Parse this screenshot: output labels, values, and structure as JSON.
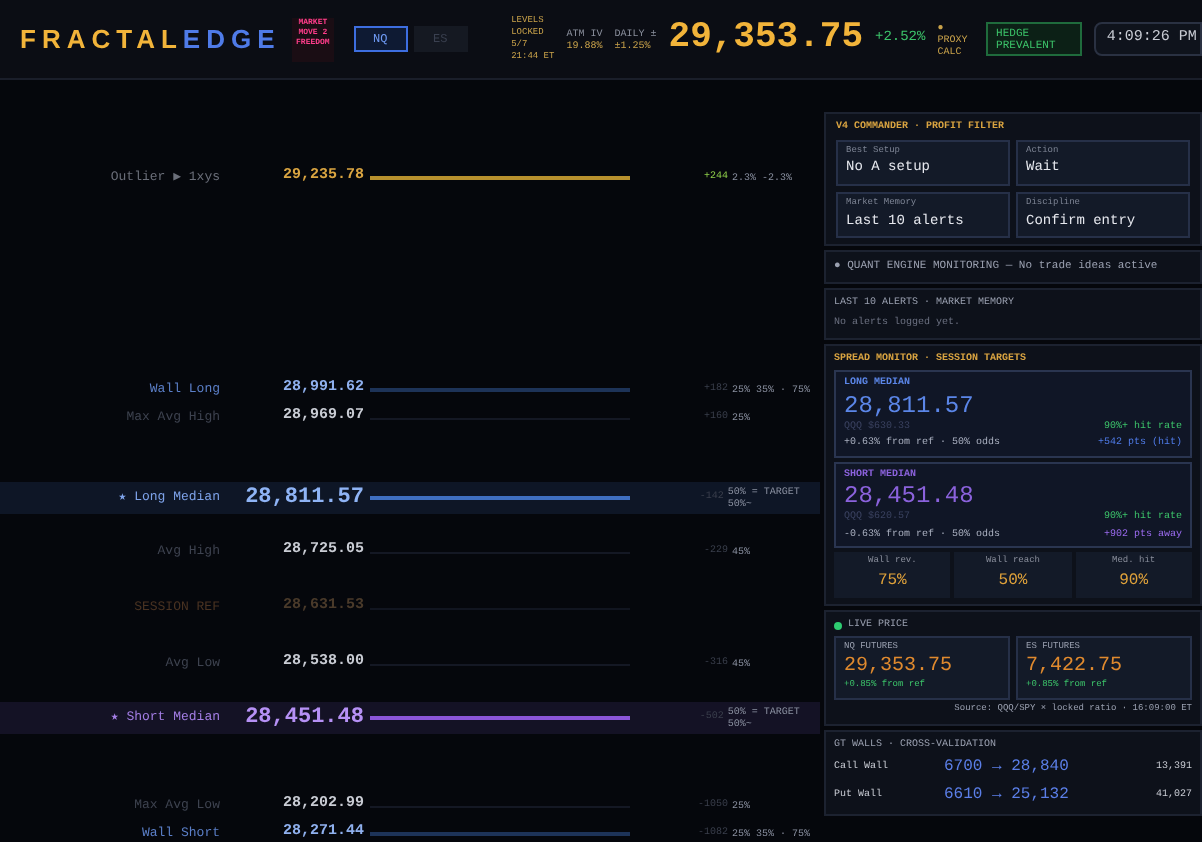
{
  "header": {
    "logo_left": "FRACTAL",
    "logo_right": "EDGE",
    "badge": "MARKET MOVE 2 FREEDOM",
    "instruments": [
      {
        "label": "NQ",
        "selected": true
      },
      {
        "label": "ES",
        "selected": false
      }
    ],
    "levels_status": "LEVELS LOCKED 5/7 21:44 ET",
    "atm_iv": {
      "label": "ATM IV",
      "value": "19.88%"
    },
    "daily": {
      "label": "DAILY ±",
      "value": "±1.25%"
    },
    "price": "29,353.75",
    "change": "+2.52%",
    "proxy": "● PROXY CALC",
    "regime": "HEDGE PREVALENT",
    "time": "4:09:26 PM"
  },
  "ladder": [
    {
      "kind": "outlier",
      "label": "Outlier ▶ 1xys",
      "price": "29,235.78",
      "delta": "+244",
      "odds": "2.3% -2.3%"
    },
    {
      "kind": "wall",
      "label": "Wall Long",
      "price": "28,991.62",
      "delta": "+182",
      "odds": "25% 35% · 75%"
    },
    {
      "kind": "minor",
      "label": "Max Avg High",
      "price": "28,969.07",
      "delta": "+160",
      "odds": "25%"
    },
    {
      "kind": "long_median",
      "label": "★ Long Median",
      "price": "28,811.57",
      "delta": "-142",
      "odds": "50% = TARGET 50%~"
    },
    {
      "kind": "minor",
      "label": "Avg High",
      "price": "28,725.05",
      "delta": "-229",
      "odds": "45%"
    },
    {
      "kind": "ref",
      "label": "SESSION REF",
      "price": "28,631.53"
    },
    {
      "kind": "minor",
      "label": "Avg Low",
      "price": "28,538.00",
      "delta": "-316",
      "odds": "45%"
    },
    {
      "kind": "short_median",
      "label": "★ Short Median",
      "price": "28,451.48",
      "delta": "-502",
      "odds": "50% = TARGET 50%~"
    },
    {
      "kind": "minor",
      "label": "Max Avg Low",
      "price": "28,202.99",
      "delta": "-1050",
      "odds": "25%"
    },
    {
      "kind": "wall",
      "label": "Wall Short",
      "price": "28,271.44",
      "delta": "-1082",
      "odds": "25% 35% · 75%"
    }
  ],
  "commander": {
    "title": "V4 COMMANDER · PROFIT FILTER",
    "cells": [
      {
        "label": "Best Setup",
        "value": "No A setup"
      },
      {
        "label": "Action",
        "value": "Wait"
      },
      {
        "label": "Market Memory",
        "value": "Last 10 alerts"
      },
      {
        "label": "Discipline",
        "value": "Confirm entry"
      }
    ]
  },
  "engine_status": "● QUANT ENGINE MONITORING — No trade ideas active",
  "alerts": {
    "title": "LAST 10 ALERTS · MARKET MEMORY",
    "empty": "No alerts logged yet."
  },
  "spread": {
    "title": "SPREAD MONITOR · SESSION TARGETS",
    "targets": [
      {
        "kind": "long",
        "label": "LONG MEDIAN",
        "price": "28,811.57",
        "proxy": "QQQ $630.33",
        "detail": "+0.63% from ref · 50% odds",
        "rate": "90%+ hit rate",
        "distance": "+542 pts (hit)"
      },
      {
        "kind": "short",
        "label": "SHORT MEDIAN",
        "price": "28,451.48",
        "proxy": "QQQ $620.57",
        "detail": "-0.63% from ref · 50% odds",
        "rate": "90%+ hit rate",
        "distance": "+902 pts away"
      }
    ],
    "stats": [
      {
        "label": "Wall rev.",
        "value": "75%"
      },
      {
        "label": "Wall reach",
        "value": "50%"
      },
      {
        "label": "Med. hit",
        "value": "90%"
      }
    ]
  },
  "live": {
    "title": "LIVE PRICE",
    "quotes": [
      {
        "label": "NQ FUTURES",
        "price": "29,353.75",
        "change": "+0.85% from ref"
      },
      {
        "label": "ES FUTURES",
        "price": "7,422.75",
        "change": "+0.85% from ref"
      }
    ],
    "source": "Source: QQQ/SPY × locked ratio · 16:09:00 ET"
  },
  "walls": {
    "title": "GT WALLS · CROSS-VALIDATION",
    "rows": [
      {
        "label": "Call Wall",
        "mapping": "6700 → 28,840",
        "oi": "13,391"
      },
      {
        "label": "Put Wall",
        "mapping": "6610 → 25,132",
        "oi": "41,027"
      }
    ]
  }
}
